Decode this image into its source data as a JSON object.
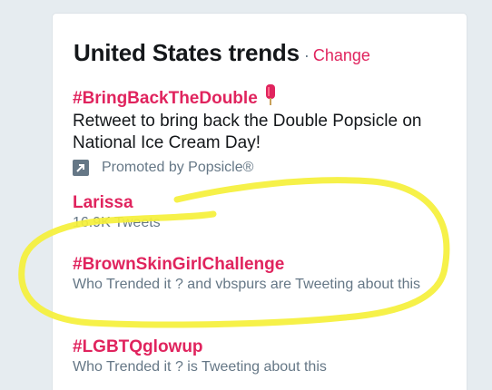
{
  "card": {
    "title": "United States trends",
    "separator": "·",
    "change_label": "Change"
  },
  "trends": [
    {
      "name": "#BringBackTheDouble",
      "description": "Retweet to bring back the Double Popsicle on National Ice Cream Day!",
      "promoted_text": "Promoted by Popsicle®",
      "icon": "popsicle-icon"
    },
    {
      "name": "Larissa",
      "meta": "16.9K Tweets"
    },
    {
      "name": "#BrownSkinGirlChallenge",
      "meta": "Who Trended it ? and vbspurs are Tweeting about this"
    },
    {
      "name": "#LGBTQglowup",
      "meta": "Who Trended it ? is Tweeting about this"
    }
  ],
  "colors": {
    "accent": "#e0245e",
    "text": "#14171a",
    "muted": "#657786",
    "highlight": "#f5f03a",
    "background": "#e6ecf0"
  }
}
